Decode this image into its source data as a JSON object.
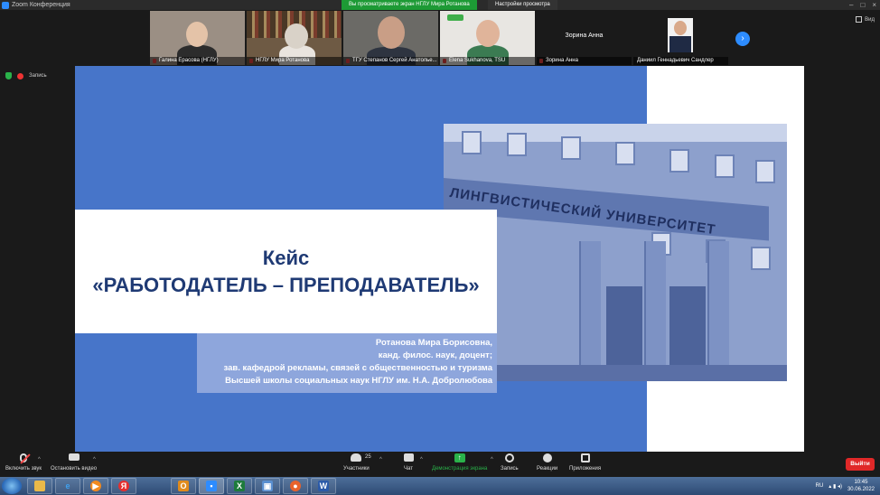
{
  "window": {
    "title": "Zoom Конференция",
    "viewing_banner": "Вы просматриваете экран НГЛУ Мира Ротанова",
    "view_settings": "Настройки просмотра",
    "view_button": "Вид"
  },
  "participants": [
    {
      "name": "Галина Ерасова (НГЛУ)"
    },
    {
      "name": "НГЛУ Мира Ротанова"
    },
    {
      "name": "ТГУ Степанов Сергей Анатолье..."
    },
    {
      "name": "Elena Sukhanova, TSU"
    },
    {
      "name": "Зорина Анна",
      "center_label": "Зорина Анна"
    },
    {
      "name": "Даниил Геннадьевич Сандлер"
    }
  ],
  "recording": {
    "label": "Запись"
  },
  "slide": {
    "title_line1": "Кейс",
    "title_line2": "«РАБОТОДАТЕЛЬ – ПРЕПОДАВАТЕЛЬ»",
    "author_lines": [
      "Ротанова Мира Борисовна,",
      "канд. филос. наук, доцент;",
      "зав. кафедрой рекламы, связей с общественностью и туризма",
      "Высшей школы социальных наук НГЛУ им. Н.А. Добролюбова"
    ],
    "building_sign": "ЛИНГВИСТИЧЕСКИЙ УНИВЕРСИТЕТ"
  },
  "toolbar": {
    "audio": "Включить звук",
    "video": "Остановить видео",
    "participants": "Участники",
    "participants_count": "25",
    "chat": "Чат",
    "share": "Демонстрация экрана",
    "record": "Запись",
    "reactions": "Реакции",
    "apps": "Приложения",
    "leave": "Выйти"
  },
  "taskbar": {
    "lang": "RU",
    "time": "10:45",
    "date": "30.06.2022"
  },
  "colors": {
    "slide_blue": "#4775c9",
    "title_navy": "#1f3a74",
    "share_green": "#2ab24a",
    "leave_red": "#e02828"
  }
}
